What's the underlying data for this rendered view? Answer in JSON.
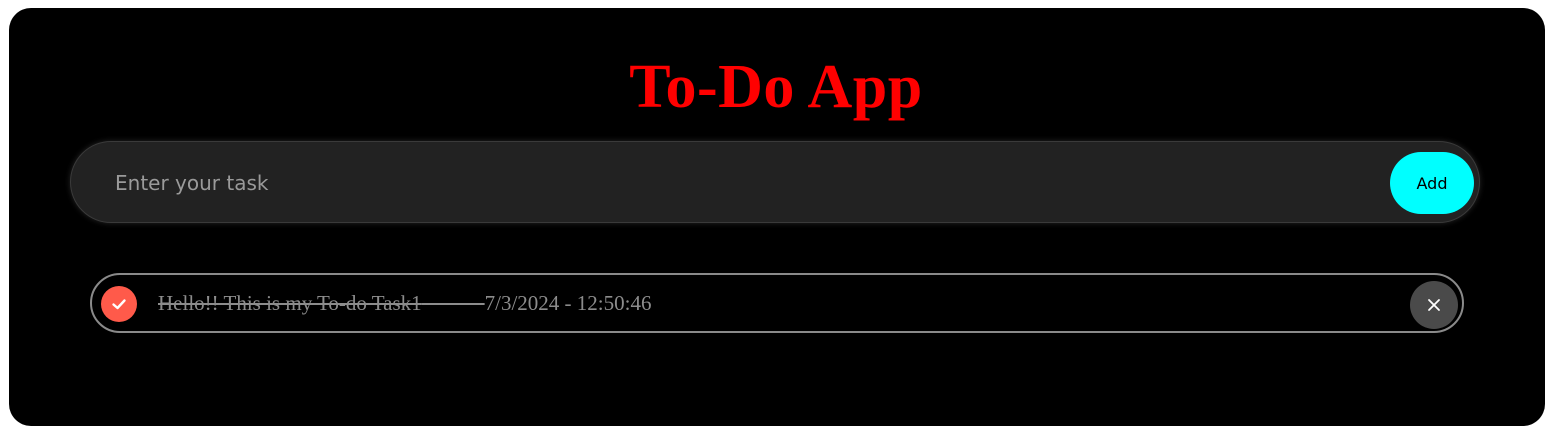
{
  "app": {
    "title": "To-Do App"
  },
  "task_input": {
    "placeholder": "Enter your task",
    "value": ""
  },
  "add_button": {
    "label": "Add"
  },
  "tasks": [
    {
      "text": "Hello!! This is my To-do Task1",
      "timestamp": "7/3/2024 - 12:50:46",
      "completed": true
    }
  ],
  "icons": {
    "check": "check-icon",
    "delete": "close-icon"
  },
  "colors": {
    "title": "#ff0000",
    "add_button": "#00ffff",
    "check_circle": "#ff5a4a",
    "background": "#000000"
  }
}
